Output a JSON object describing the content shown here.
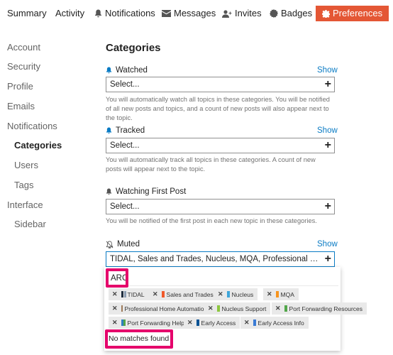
{
  "nav": {
    "summary": "Summary",
    "activity": "Activity",
    "notifications": "Notifications",
    "messages": "Messages",
    "invites": "Invites",
    "badges": "Badges",
    "preferences": "Preferences"
  },
  "sidebar": {
    "items": [
      "Account",
      "Security",
      "Profile",
      "Emails",
      "Notifications",
      "Categories",
      "Users",
      "Tags",
      "Interface",
      "Sidebar"
    ]
  },
  "main": {
    "title": "Categories",
    "watched": {
      "label": "Watched",
      "show": "Show",
      "value": "Select...",
      "description": "You will automatically watch all topics in these categories. You will be notified of all new posts and topics, and a count of new posts will also appear next to the topic."
    },
    "tracked": {
      "label": "Tracked",
      "show": "Show",
      "value": "Select...",
      "description": "You will automatically track all topics in these categories. A count of new posts will appear next to the topic."
    },
    "watching_first": {
      "label": "Watching First Post",
      "value": "Select...",
      "description": "You will be notified of the first post in each new topic in these categories."
    },
    "muted": {
      "label": "Muted",
      "show": "Show",
      "value": "TIDAL, Sales and Trades, Nucleus, MQA, Professional Home Automation, Nucleus Support, Port Forwarding Resources, Port Forwarding Help, Early Access, Early Access Info"
    }
  },
  "dropdown": {
    "filter_value": "ARC",
    "no_matches": "No matches found",
    "chips": [
      {
        "label": "TIDAL",
        "color": "#1f2d3d"
      },
      {
        "label": "Sales and Trades",
        "color": "#f1592a"
      },
      {
        "label": "Nucleus",
        "color": "#3da5d9"
      },
      {
        "label": "MQA",
        "color": "#f7941d"
      },
      {
        "label": "Professional Home Automation",
        "color": "#9e7b5a"
      },
      {
        "label": "Nucleus Support",
        "color": "#8dc63f"
      },
      {
        "label": "Port Forwarding Resources",
        "color": "#52a74a"
      },
      {
        "label": "Port Forwarding Help",
        "color": "#2f7fc1"
      },
      {
        "label": "Early Access",
        "color": "#0b5394"
      },
      {
        "label": "Early Access Info",
        "color": "#3a7bd5"
      }
    ]
  },
  "colors": {
    "accent": "#e45735",
    "link": "#0a7bc4",
    "highlight": "#e5006b"
  }
}
